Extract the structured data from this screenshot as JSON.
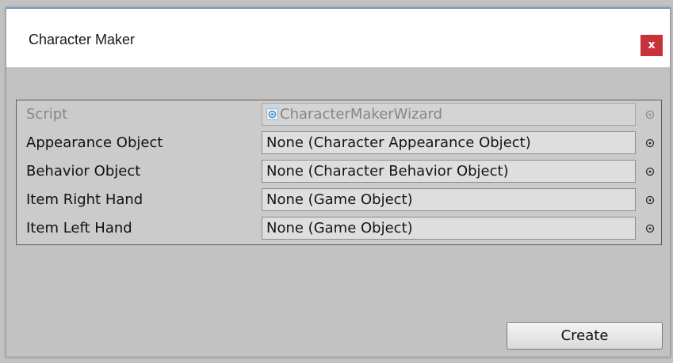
{
  "window": {
    "title": "Character Maker",
    "close_label": "x"
  },
  "fields": [
    {
      "label": "Script",
      "value": "CharacterMakerWizard",
      "disabled": true,
      "icon": "script-icon"
    },
    {
      "label": "Appearance Object",
      "value": "None (Character Appearance Object)",
      "disabled": false
    },
    {
      "label": "Behavior Object",
      "value": "None (Character Behavior Object)",
      "disabled": false
    },
    {
      "label": "Item Right Hand",
      "value": "None (Game Object)",
      "disabled": false
    },
    {
      "label": "Item Left Hand",
      "value": "None (Game Object)",
      "disabled": false
    }
  ],
  "buttons": {
    "create_label": "Create"
  },
  "colors": {
    "close_button": "#c7333b",
    "title_accent": "#3c84d6",
    "panel_background": "#c2c2c2"
  }
}
